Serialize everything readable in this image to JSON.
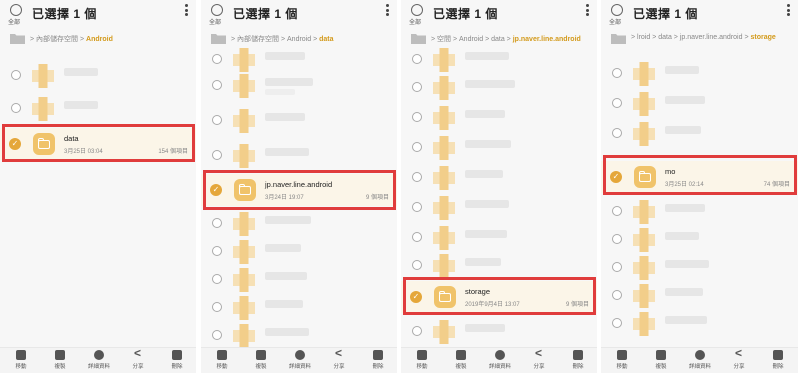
{
  "common": {
    "select_all_label": "全部",
    "selection_title": "已選擇 1 個",
    "actions": [
      "移動",
      "複製",
      "詳細資料",
      "分享",
      "刪除"
    ]
  },
  "panels": [
    {
      "path_prefix": " > 內部儲存空間 > ",
      "path_current": "Android",
      "selected": {
        "name": "data",
        "date": "3月25日 03:04",
        "count": "154 個項目"
      }
    },
    {
      "path_prefix": " > 內部儲存空間 > Android > ",
      "path_current": "data",
      "selected": {
        "name": "jp.naver.line.android",
        "date": "3月24日 19:07",
        "count": "9 個項目"
      }
    },
    {
      "path_prefix": " > 空間 > Android > data > ",
      "path_current": "jp.naver.line.android",
      "selected": {
        "name": "storage",
        "date": "2019年9月4日 13:07",
        "count": "9 個項目"
      }
    },
    {
      "path_prefix": " > lroid > data > jp.naver.line.android > ",
      "path_current": "storage",
      "selected": {
        "name": "mo",
        "date": "3月25日 02:14",
        "count": "74 個項目"
      }
    }
  ],
  "colors": {
    "accent": "#e5a73a",
    "highlight": "#e03c3c",
    "path_current": "#d39a1b"
  },
  "icons": [
    "home-folder-icon",
    "more-vert-icon",
    "folder-icon",
    "check-icon",
    "move-icon",
    "copy-icon",
    "info-icon",
    "share-icon",
    "delete-icon"
  ]
}
